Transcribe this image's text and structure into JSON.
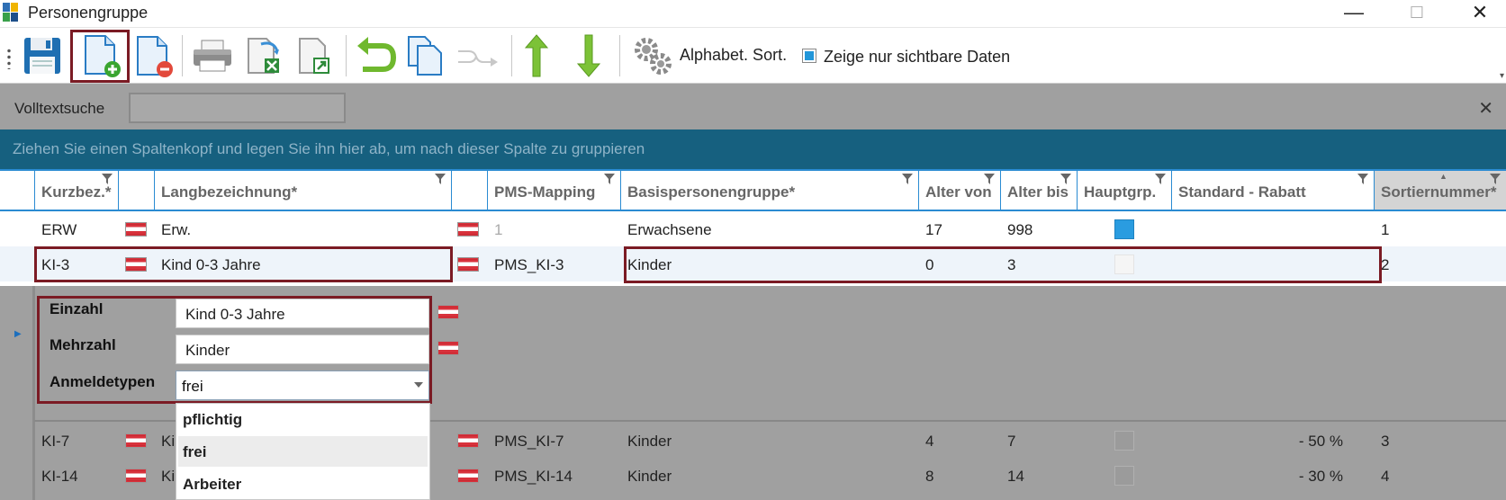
{
  "window": {
    "title": "Personengruppe",
    "minimize_label": "—",
    "maximize_label": "☐",
    "close_label": "✕"
  },
  "toolbar": {
    "sort_label": "Alphabet. Sort.",
    "visible_only_label": "Zeige nur sichtbare Daten",
    "visible_only_checked": true
  },
  "search": {
    "label": "Volltextsuche",
    "value": "",
    "close_label": "✕"
  },
  "group_panel_text": "Ziehen Sie einen Spaltenkopf und legen Sie ihn hier ab, um nach dieser Spalte zu gruppieren",
  "grid": {
    "columns": {
      "kurzbez": "Kurzbez.*",
      "langbez": "Langbezeichnung*",
      "pms": "PMS-Mapping",
      "basis": "Basispersonengruppe*",
      "alter_von": "Alter von",
      "alter_bis": "Alter bis",
      "hauptgrp": "Hauptgrp.",
      "rabatt": "Standard - Rabatt",
      "sort": "Sortiernummer*"
    },
    "rows": [
      {
        "kurzbez": "ERW",
        "langbez": "Erw.",
        "pms": "1",
        "basis": "Erwachsene",
        "alter_von": "17",
        "alter_bis": "998",
        "hauptgrp": true,
        "rabatt": "",
        "sort": "1"
      },
      {
        "kurzbez": "KI-3",
        "langbez": "Kind 0-3 Jahre",
        "pms": "PMS_KI-3",
        "basis": "Kinder",
        "alter_von": "0",
        "alter_bis": "3",
        "hauptgrp": false,
        "rabatt": "",
        "sort": "2"
      },
      {
        "kurzbez": "KI-7",
        "langbez": "Ki",
        "pms": "PMS_KI-7",
        "basis": "Kinder",
        "alter_von": "4",
        "alter_bis": "7",
        "hauptgrp": false,
        "rabatt": "- 50 %",
        "sort": "3"
      },
      {
        "kurzbez": "KI-14",
        "langbez": "Ki",
        "pms": "PMS_KI-14",
        "basis": "Kinder",
        "alter_von": "8",
        "alter_bis": "14",
        "hauptgrp": false,
        "rabatt": "- 30 %",
        "sort": "4"
      }
    ]
  },
  "detail": {
    "einzahl_label": "Einzahl",
    "einzahl_value": "Kind 0-3 Jahre",
    "mehrzahl_label": "Mehrzahl",
    "mehrzahl_value": "Kinder",
    "anmeldetypen_label": "Anmeldetypen",
    "anmeldetypen_value": "frei",
    "anmeldetypen_options": [
      "pflichtig",
      "frei",
      "Arbeiter"
    ]
  },
  "colors": {
    "accent": "#2a8bd2",
    "group_banner": "#16607f",
    "highlight_outline": "#7b1b24",
    "checkbox_fill": "#2196d9"
  }
}
